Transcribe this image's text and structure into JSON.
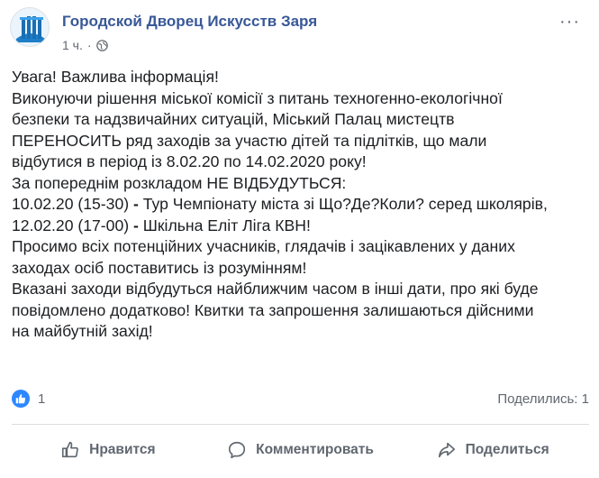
{
  "post": {
    "page_name": "Городской Дворец Искусств Заря",
    "time": "1 ч.",
    "separator": "·",
    "audience_icon": "globe-icon",
    "options_icon": "more-options-icon",
    "options_glyph": "···",
    "body_lines": [
      [
        {
          "t": "Увага! Важлива інформація!"
        }
      ],
      [
        {
          "t": "Виконуючи рішення міської комісії з питань техногенно-екологічної"
        }
      ],
      [
        {
          "t": "безпеки та надзвичайних ситуацій, Міський Палац мистецтв"
        }
      ],
      [
        {
          "t": "ПЕРЕНОСИТЬ ряд заходів за участю дітей та підлітків, що мали"
        }
      ],
      [
        {
          "t": "відбутися в період із 8.02.20 по 14.02.2020 року!"
        }
      ],
      [
        {
          "t": "За попереднім розкладом НЕ ВІДБУДУТЬСЯ:"
        }
      ],
      [
        {
          "t": "10.02.20 (15-30) "
        },
        {
          "t": "-",
          "b": true
        },
        {
          "t": " Тур Чемпіонату міста зі Що?Де?Коли? серед школярів,"
        }
      ],
      [
        {
          "t": "12.02.20 (17-00) "
        },
        {
          "t": "-",
          "b": true
        },
        {
          "t": " Шкільна Еліт Ліга КВН!"
        }
      ],
      [
        {
          "t": "Просимо всіх потенційних учасників, глядачів і зацікавлених у даних"
        }
      ],
      [
        {
          "t": "заходах осіб поставитись із розумінням!"
        }
      ],
      [
        {
          "t": "Вказані заходи відбудуться найближчим часом в інші дати, про які буде"
        }
      ],
      [
        {
          "t": "повідомлено додатково! Квитки та запрошення залишаються дійсними"
        }
      ],
      [
        {
          "t": "на майбутній захід!"
        }
      ]
    ]
  },
  "stats": {
    "reaction_icon": "like-icon",
    "likes": "1",
    "shares": "Поделились: 1"
  },
  "actions": {
    "like_label": "Нравится",
    "comment_label": "Комментировать",
    "share_label": "Поделиться"
  },
  "colors": {
    "page_name": "#385898",
    "secondary_text": "#606770",
    "like_badge": "#2d88ff",
    "divider": "#dadde1"
  }
}
